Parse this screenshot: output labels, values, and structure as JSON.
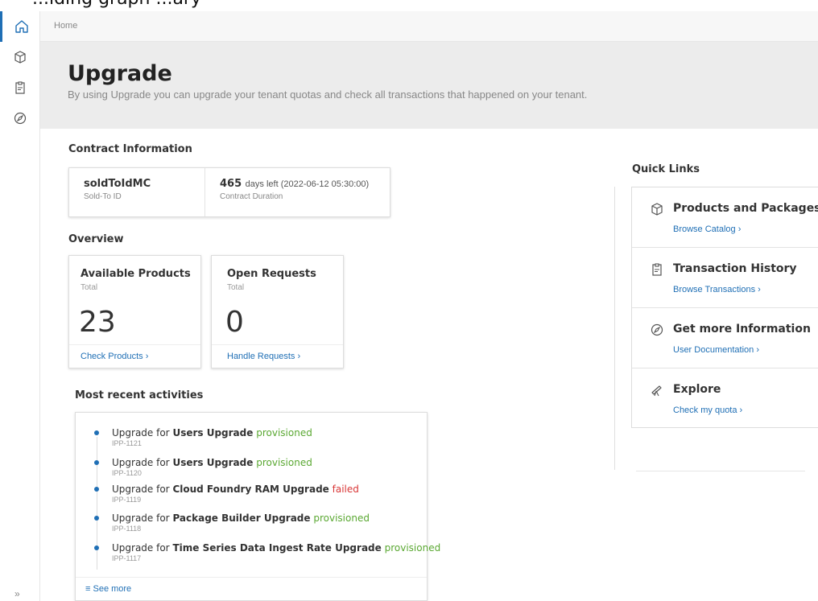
{
  "top_cut_text": "...lding graph                                              ...ary",
  "breadcrumb": "Home",
  "header": {
    "title": "Upgrade",
    "subtitle": "By using Upgrade you can upgrade your tenant quotas and check all transactions that happened on your tenant."
  },
  "contract": {
    "section_title": "Contract Information",
    "sold_to_value": "soldToIdMC",
    "sold_to_label": "Sold-To ID",
    "days_value": "465",
    "days_text": "days left (2022-06-12 05:30:00)",
    "duration_label": "Contract Duration"
  },
  "overview": {
    "section_title": "Overview",
    "products": {
      "title": "Available Products",
      "sub": "Total",
      "value": "23",
      "link": "Check Products ›"
    },
    "requests": {
      "title": "Open Requests",
      "sub": "Total",
      "value": "0",
      "link": "Handle Requests ›"
    }
  },
  "activities": {
    "section_title": "Most recent activities",
    "prefix": "Upgrade for",
    "items": [
      {
        "name": "Users Upgrade",
        "status": "provisioned",
        "id": "IPP-1121"
      },
      {
        "name": "Users Upgrade",
        "status": "provisioned",
        "id": "IPP-1120"
      },
      {
        "name": "Cloud Foundry RAM Upgrade",
        "status": "failed",
        "id": "IPP-1119"
      },
      {
        "name": "Package Builder Upgrade",
        "status": "provisioned",
        "id": "IPP-1118"
      },
      {
        "name": "Time Series Data Ingest Rate Upgrade",
        "status": "provisioned",
        "id": "IPP-1117"
      }
    ],
    "see_more": "See more"
  },
  "quick_links": {
    "section_title": "Quick Links",
    "items": [
      {
        "title": "Products and Packages",
        "link": "Browse Catalog ›",
        "icon": "cube-icon"
      },
      {
        "title": "Transaction History",
        "link": "Browse Transactions ›",
        "icon": "clipboard-icon"
      },
      {
        "title": "Get more Information",
        "link": "User Documentation ›",
        "icon": "compass-icon"
      },
      {
        "title": "Explore",
        "link": "Check my quota ›",
        "icon": "telescope-icon"
      }
    ]
  },
  "colors": {
    "accent": "#1f6fb5",
    "success": "#5aa832",
    "error": "#d93737",
    "header_bg": "#ececec"
  }
}
